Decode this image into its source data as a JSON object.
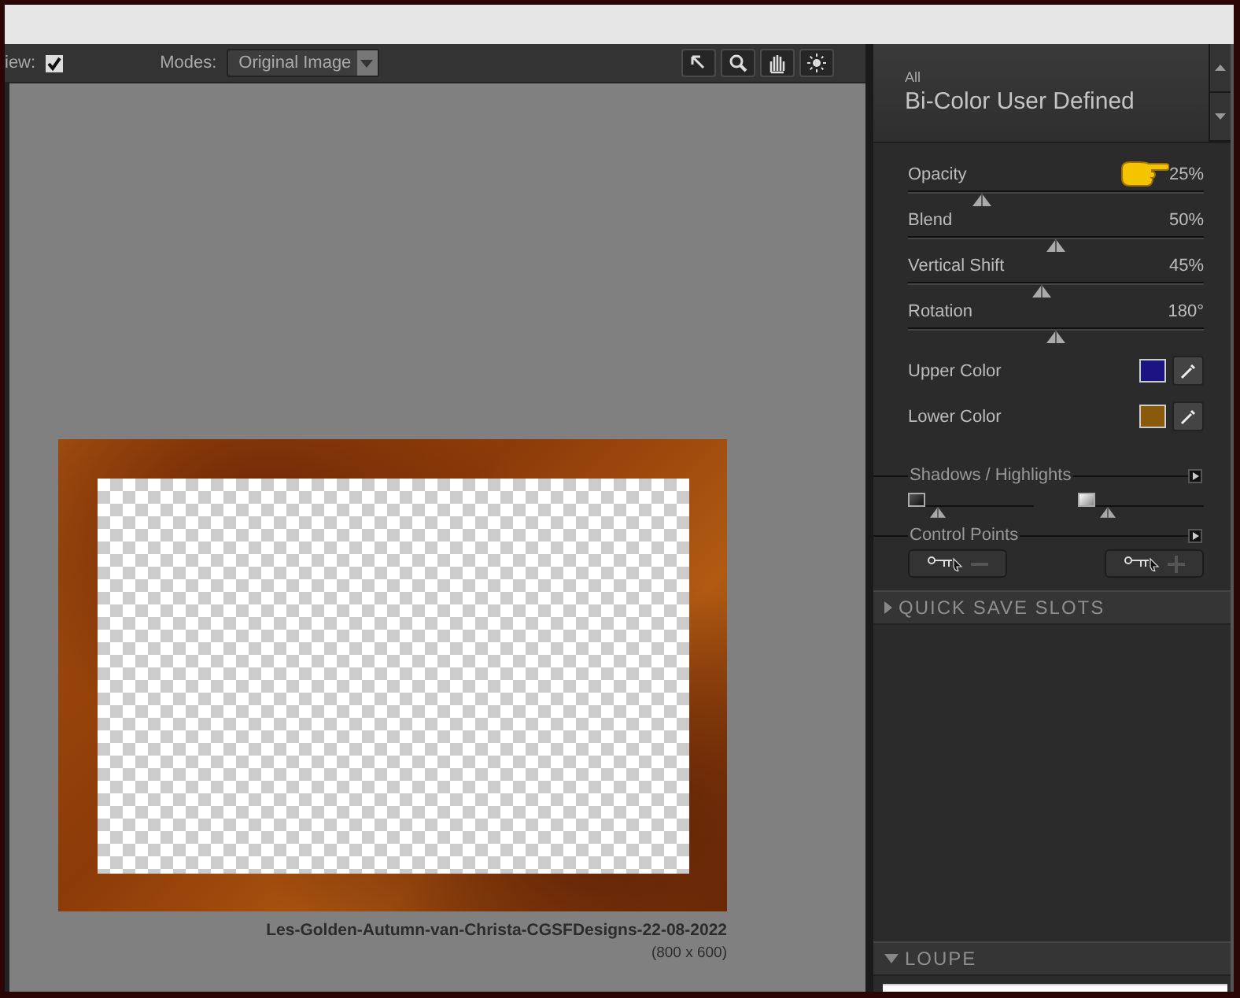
{
  "toolbar": {
    "preview_label": "iew:",
    "preview_checked": true,
    "modes_label": "Modes:",
    "mode_value": "Original Image"
  },
  "image": {
    "filename": "Les-Golden-Autumn-van-Christa-CGSFDesigns-22-08-2022",
    "dimensions": "(800 x 600)"
  },
  "panel": {
    "category": "All",
    "filter_name": "Bi-Color User Defined",
    "sliders": [
      {
        "label": "Opacity",
        "value": "25%",
        "level": 0.25,
        "pointer_annotation": true
      },
      {
        "label": "Blend",
        "value": "50%",
        "level": 0.5,
        "pointer_annotation": false
      },
      {
        "label": "Vertical Shift",
        "value": "45%",
        "level": 0.45,
        "pointer_annotation": false
      },
      {
        "label": "Rotation",
        "value": "180°",
        "level": 0.5,
        "pointer_annotation": false
      }
    ],
    "colors": [
      {
        "label": "Upper Color",
        "color": "#1c1480"
      },
      {
        "label": "Lower Color",
        "color": "#8a5a0c"
      }
    ],
    "shadows_highlights": {
      "title": "Shadows / Highlights",
      "sliders": [
        {
          "kind": "shadow",
          "level": 0.05
        },
        {
          "kind": "highlight",
          "level": 0.05
        }
      ]
    },
    "control_points": {
      "title": "Control Points",
      "buttons": [
        {
          "kind": "remove"
        },
        {
          "kind": "add"
        }
      ]
    },
    "collapsible_sections": [
      {
        "title": "QUICK SAVE SLOTS",
        "expanded": false
      },
      {
        "title": "LOUPE",
        "expanded": true
      }
    ]
  }
}
